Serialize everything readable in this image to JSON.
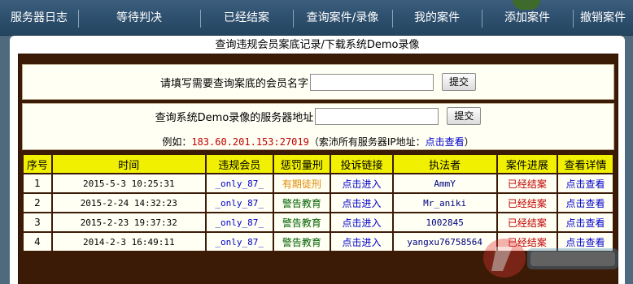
{
  "nav": {
    "items": [
      {
        "label": "服务器日志"
      },
      {
        "label": "等待判决"
      },
      {
        "label": "已经结案"
      },
      {
        "label": "查询案件/录像"
      },
      {
        "label": "我的案件"
      },
      {
        "label": "添加案件"
      },
      {
        "label": "撤销案件"
      }
    ]
  },
  "panel": {
    "title": "查询违规会员案底记录/下载系统Demo录像"
  },
  "member_query": {
    "label": "请填写需要查询案底的会员名字",
    "value": "",
    "button": "提交"
  },
  "demo_query": {
    "label": "查询系统Demo录像的服务器地址",
    "value": "",
    "button": "提交",
    "example_prefix": "例如：",
    "example_addr": "183.60.201.153:27019",
    "example_note_prefix": "（索沛所有服务器IP地址：",
    "example_link": "点击查看",
    "example_note_suffix": "）"
  },
  "table": {
    "headers": [
      "序号",
      "时间",
      "违规会员",
      "惩罚量刑",
      "投诉链接",
      "执法者",
      "案件进展",
      "查看详情"
    ],
    "rows": [
      {
        "seq": "1",
        "time": "2015-5-3 10:25:31",
        "member": "_only_87_",
        "punishment": "有期徒刑",
        "complaint": "点击进入",
        "enforcer": "AmmY",
        "progress": "已经结案",
        "detail": "点击查看"
      },
      {
        "seq": "2",
        "time": "2015-2-24 14:32:23",
        "member": "_only_87_",
        "punishment": "警告教育",
        "complaint": "点击进入",
        "enforcer": "Mr_aniki",
        "progress": "已经结案",
        "detail": "点击查看"
      },
      {
        "seq": "3",
        "time": "2015-2-23 19:37:32",
        "member": "_only_87_",
        "punishment": "警告教育",
        "complaint": "点击进入",
        "enforcer": "1002845",
        "progress": "已经结案",
        "detail": "点击查看"
      },
      {
        "seq": "4",
        "time": "2014-2-3 16:49:11",
        "member": "_only_87_",
        "punishment": "警告教育",
        "complaint": "点击进入",
        "enforcer": "yangxu76758564",
        "progress": "已经结案",
        "detail": "点击查看"
      }
    ]
  },
  "colors": {
    "nav_bg": "#2f5170",
    "page_bg": "#4f6a7e",
    "frame": "#3c1b06",
    "header_yellow": "#f0f000",
    "red_text": "#c00000",
    "green_text": "#006000",
    "orange_text": "#e08a00",
    "link_blue": "#0000cc"
  }
}
